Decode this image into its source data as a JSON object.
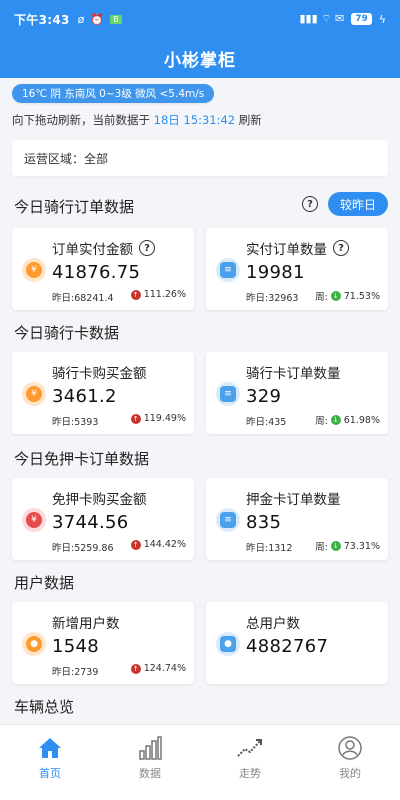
{
  "status": {
    "time": "下午3:43",
    "indicators": [
      "ø",
      "⏰"
    ],
    "notif_badge": "B",
    "right_text": "▮▮▮ ⌔ ✉",
    "battery": "79",
    "charge": "ϟ"
  },
  "app": {
    "title": "小彬掌柜"
  },
  "weather": {
    "text": "16℃ 阴 东南风 0~3级 微风 <5.4m/s"
  },
  "refresh": {
    "prefix": "向下拖动刷新，当前数据于 ",
    "date": "18日 15:31:42",
    "suffix": " 刷新"
  },
  "region": {
    "text": "运营区域：全部"
  },
  "sections": {
    "ride_orders": "今日骑行订单数据",
    "ride_cards": "今日骑行卡数据",
    "deposit_free": "今日免押卡订单数据",
    "users": "用户数据",
    "vehicles": "车辆总览"
  },
  "compare_button": "较昨日",
  "help_glyph": "?",
  "cards": {
    "c1": {
      "label": "订单实付金额",
      "value": "41876.75",
      "yesterday": "昨日:68241.4",
      "change": "111.26%",
      "dir": "↑",
      "icon": "¥"
    },
    "c2": {
      "label": "实付订单数量",
      "value": "19981",
      "yesterday": "昨日:32963",
      "week": "周:",
      "change": "71.53%",
      "dir": "↓",
      "icon": "≡"
    },
    "c3": {
      "label": "骑行卡购买金额",
      "value": "3461.2",
      "yesterday": "昨日:5393",
      "change": "119.49%",
      "dir": "↑",
      "icon": "¥"
    },
    "c4": {
      "label": "骑行卡订单数量",
      "value": "329",
      "yesterday": "昨日:435",
      "week": "周:",
      "change": "61.98%",
      "dir": "↓",
      "icon": "≡"
    },
    "c5": {
      "label": "免押卡购买金额",
      "value": "3744.56",
      "yesterday": "昨日:5259.86",
      "change": "144.42%",
      "dir": "↑",
      "icon": "¥"
    },
    "c6": {
      "label": "押金卡订单数量",
      "value": "835",
      "yesterday": "昨日:1312",
      "week": "周:",
      "change": "73.31%",
      "dir": "↓",
      "icon": "≡"
    },
    "c7": {
      "label": "新增用户数",
      "value": "1548",
      "yesterday": "昨日:2739",
      "change": "124.74%",
      "dir": "↑",
      "icon": "●"
    },
    "c8": {
      "label": "总用户数",
      "value": "4882767",
      "icon": "●"
    }
  },
  "tabs": [
    "首页",
    "数据",
    "走势",
    "我的"
  ]
}
